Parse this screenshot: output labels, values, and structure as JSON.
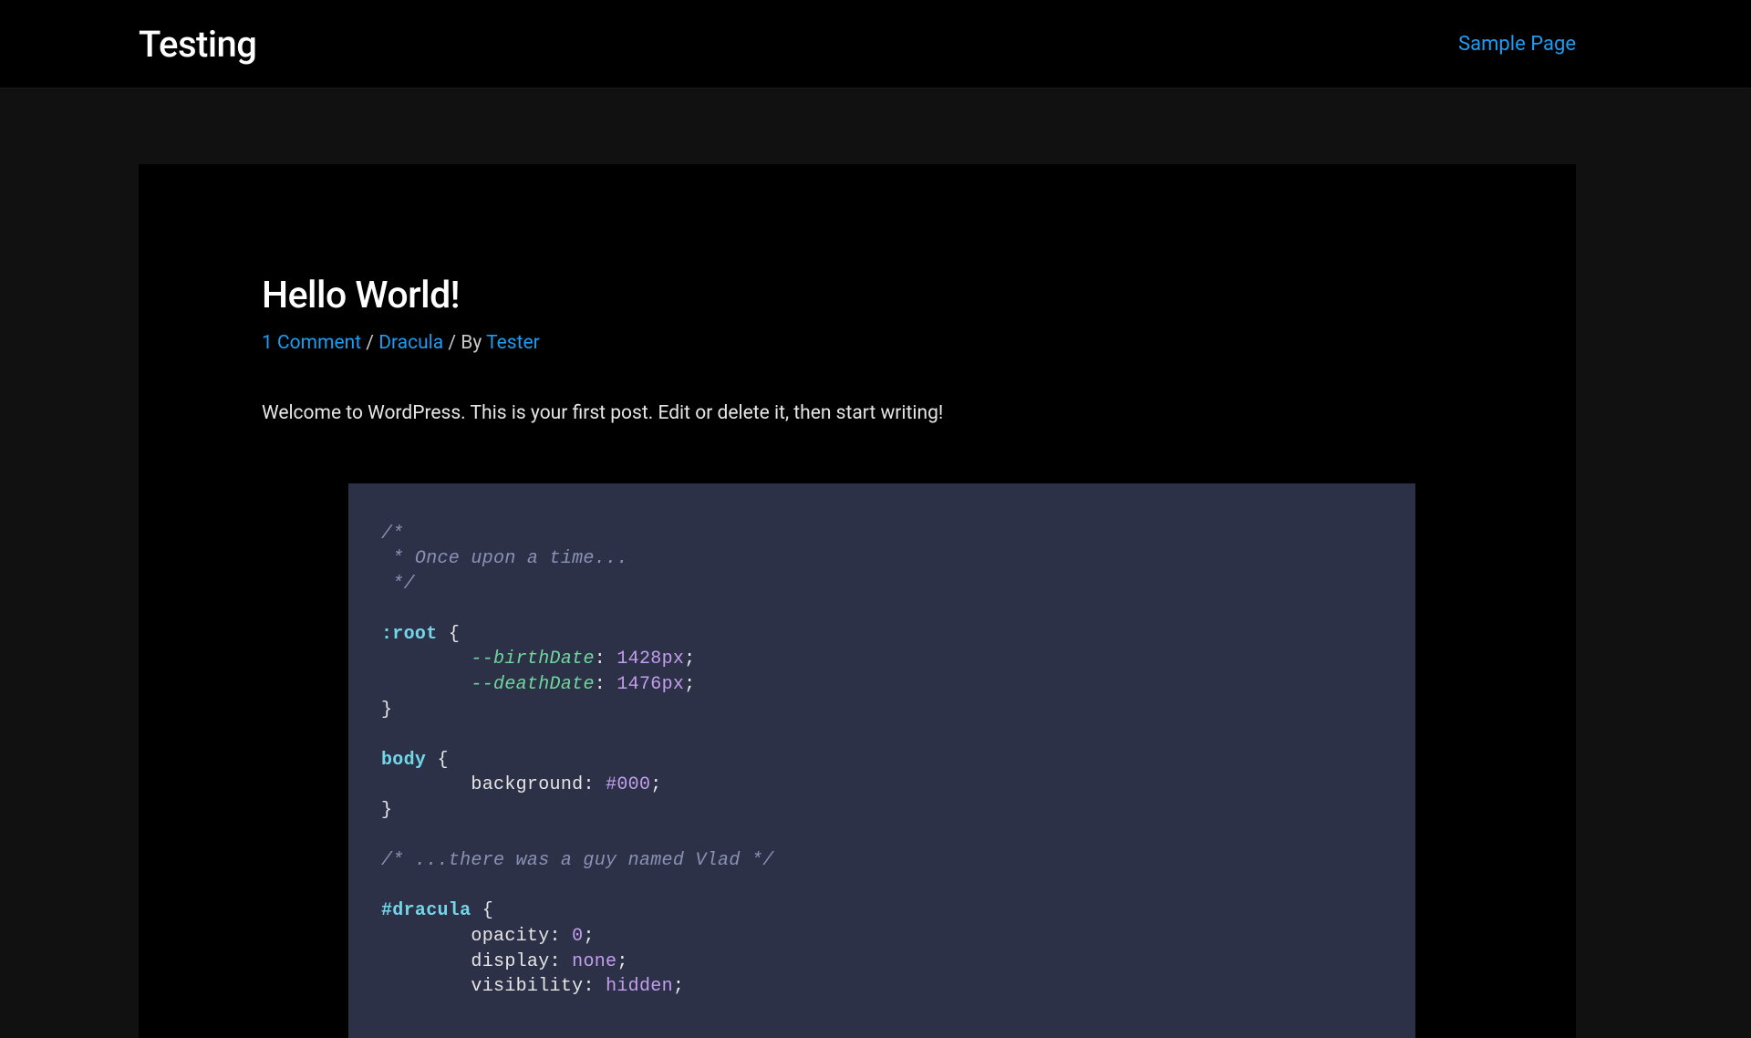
{
  "header": {
    "site_title": "Testing",
    "nav_link": "Sample Page"
  },
  "post": {
    "title": "Hello World!",
    "meta": {
      "comments": "1 Comment",
      "sep1": " / ",
      "category": "Dracula",
      "sep2": " / By ",
      "author": "Tester"
    },
    "body": "Welcome to WordPress. This is your first post. Edit or delete it, then start writing!"
  },
  "code": {
    "c1_l1": "/*",
    "c1_l2": " * Once upon a time...",
    "c1_l3": " */",
    "sel_root": ":root",
    "brace_open": " {",
    "indent2": "        ",
    "var_birth": "--birthDate",
    "colon_sp": ": ",
    "val_1428": "1428px",
    "semi": ";",
    "var_death": "--deathDate",
    "val_1476": "1476px",
    "brace_close": "}",
    "sel_body": "body",
    "prop_background": "background",
    "val_black": "#000",
    "c2": "/* ...there was a guy named Vlad */",
    "sel_dracula": "#dracula",
    "prop_opacity": "opacity",
    "val_0": "0",
    "prop_display": "display",
    "val_none": "none",
    "prop_visibility": "visibility",
    "val_hidden": "hidden"
  }
}
